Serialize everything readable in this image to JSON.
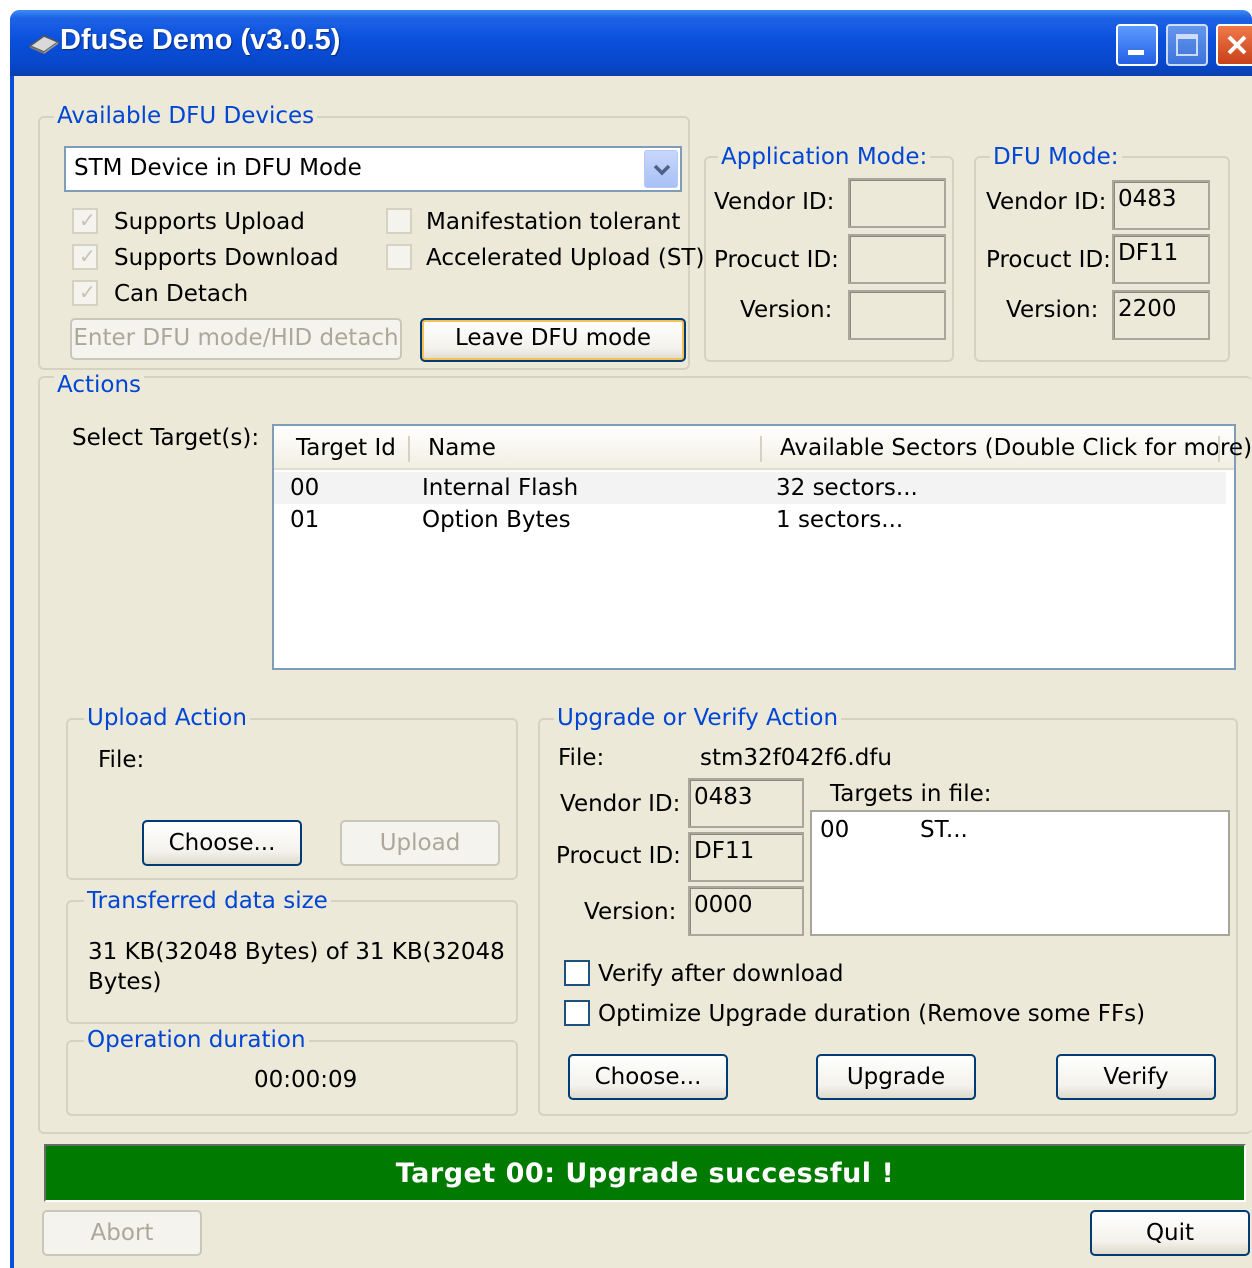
{
  "window": {
    "title": "DfuSe Demo (v3.0.5)",
    "controls": [
      "minimize-icon",
      "maximize-icon",
      "close-icon"
    ]
  },
  "devices": {
    "group_label": "Available DFU Devices",
    "selected": "STM Device in DFU Mode",
    "checkboxes": [
      {
        "label": "Supports Upload",
        "checked": true,
        "enabled": false
      },
      {
        "label": "Supports Download",
        "checked": true,
        "enabled": false
      },
      {
        "label": "Can Detach",
        "checked": true,
        "enabled": false
      },
      {
        "label": "Manifestation tolerant",
        "checked": false,
        "enabled": false
      },
      {
        "label": "Accelerated Upload (ST)",
        "checked": false,
        "enabled": false
      }
    ],
    "enter_dfu_label": "Enter DFU mode/HID detach",
    "leave_dfu_label": "Leave DFU mode"
  },
  "app_mode": {
    "group_label": "Application Mode:",
    "vendor_label": "Vendor ID:",
    "product_label": "Procuct ID:",
    "version_label": "Version:",
    "vendor_value": "",
    "product_value": "",
    "version_value": ""
  },
  "dfu_mode": {
    "group_label": "DFU Mode:",
    "vendor_label": "Vendor ID:",
    "product_label": "Procuct ID:",
    "version_label": "Version:",
    "vendor_value": "0483",
    "product_value": "DF11",
    "version_value": "2200"
  },
  "actions": {
    "group_label": "Actions",
    "select_targets_label": "Select Target(s):",
    "columns": [
      "Target Id",
      "Name",
      "Available Sectors (Double Click for more)"
    ],
    "rows": [
      {
        "id": "00",
        "name": "Internal Flash",
        "sectors": "32 sectors..."
      },
      {
        "id": "01",
        "name": "Option Bytes",
        "sectors": "1 sectors..."
      }
    ]
  },
  "upload": {
    "group_label": "Upload Action",
    "file_label": "File:",
    "choose_label": "Choose...",
    "upload_label": "Upload"
  },
  "transferred": {
    "group_label": "Transferred data size",
    "line1": "31 KB(32048 Bytes) of 31 KB(32048",
    "line2": "Bytes)"
  },
  "duration": {
    "group_label": "Operation duration",
    "value": "00:00:09"
  },
  "upgrade": {
    "group_label": "Upgrade or Verify Action",
    "file_label": "File:",
    "file_value": "stm32f042f6.dfu",
    "vendor_label": "Vendor ID:",
    "vendor_value": "0483",
    "product_label": "Procuct ID:",
    "product_value": "DF11",
    "version_label": "Version:",
    "version_value": "0000",
    "targets_label": "Targets in file:",
    "targets": [
      {
        "id": "00",
        "name": "ST..."
      }
    ],
    "verify_after_label": "Verify after download",
    "optimize_label": "Optimize Upgrade duration (Remove some FFs)",
    "choose_label": "Choose...",
    "upgrade_label": "Upgrade",
    "verify_label": "Verify"
  },
  "status": {
    "message": "Target 00: Upgrade successful !",
    "color": "#007a00"
  },
  "footer": {
    "abort_label": "Abort",
    "quit_label": "Quit"
  }
}
